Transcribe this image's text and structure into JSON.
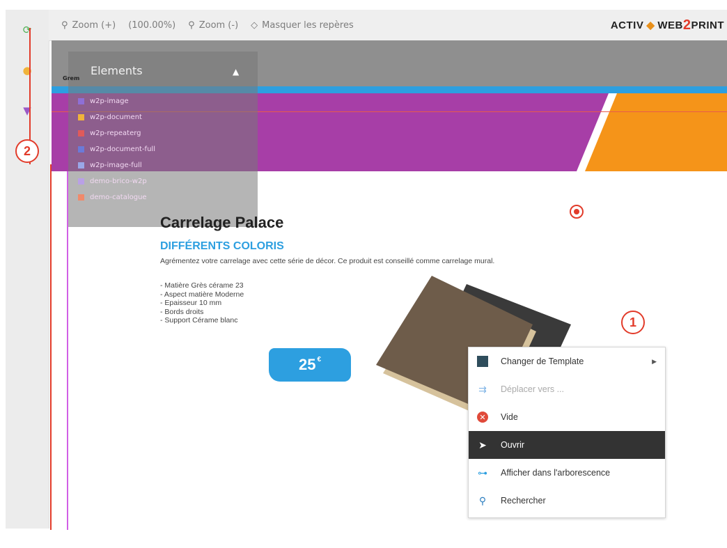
{
  "toolbar": {
    "zoom_in": "Zoom (+)",
    "zoom_level": "(100.00%)",
    "zoom_out": "Zoom (-)",
    "toggle_guides": "Masquer les repères",
    "logo_part1": "ACTIV",
    "logo_part2": "WEB",
    "logo_part3": "2",
    "logo_part4": "PRINT"
  },
  "annotations": {
    "one": "1",
    "two": "2"
  },
  "elements_panel": {
    "title": "Elements",
    "tag": "Grem",
    "items": [
      {
        "label": "w2p-image",
        "color": "#8e6fd6"
      },
      {
        "label": "w2p-document",
        "color": "#f0b33a"
      },
      {
        "label": "w2p-repeaterg",
        "color": "#e05a5a"
      },
      {
        "label": "w2p-document-full",
        "color": "#6b7ad8"
      },
      {
        "label": "w2p-image-full",
        "color": "#9aa7e8"
      },
      {
        "label": "demo-brico-w2p",
        "color": "#b9a0e6"
      },
      {
        "label": "demo-catalogue",
        "color": "#f08a6b"
      }
    ]
  },
  "product": {
    "title": "Carrelage Palace",
    "subtitle": "DIFFÉRENTS COLORIS",
    "description": "Agrémentez votre carrelage avec cette série de décor. Ce produit est conseillé comme carrelage mural.",
    "specs": [
      "- Matière Grès cérame 23",
      "- Aspect matière Moderne",
      "- Epaisseur 10 mm",
      "- Bords droits",
      "- Support Cérame blanc"
    ],
    "price": "25",
    "currency": "€"
  },
  "context_menu": {
    "items": [
      {
        "label": "Changer de Template",
        "icon": "template-icon",
        "state": "normal",
        "has_submenu": true
      },
      {
        "label": "Déplacer vers ...",
        "icon": "move-icon",
        "state": "disabled",
        "has_submenu": false
      },
      {
        "label": "Vide",
        "icon": "empty-icon",
        "state": "normal",
        "has_submenu": false
      },
      {
        "label": "Ouvrir",
        "icon": "cursor-icon",
        "state": "active",
        "has_submenu": false
      },
      {
        "label": "Afficher dans l'arborescence",
        "icon": "tree-icon",
        "state": "normal",
        "has_submenu": false
      },
      {
        "label": "Rechercher",
        "icon": "search-icon",
        "state": "normal",
        "has_submenu": false
      }
    ]
  },
  "colors": {
    "accent_blue": "#2d9fe0",
    "purple_band": "#a73ea7",
    "orange_band": "#f59419",
    "annotation_red": "#e23b2a"
  }
}
